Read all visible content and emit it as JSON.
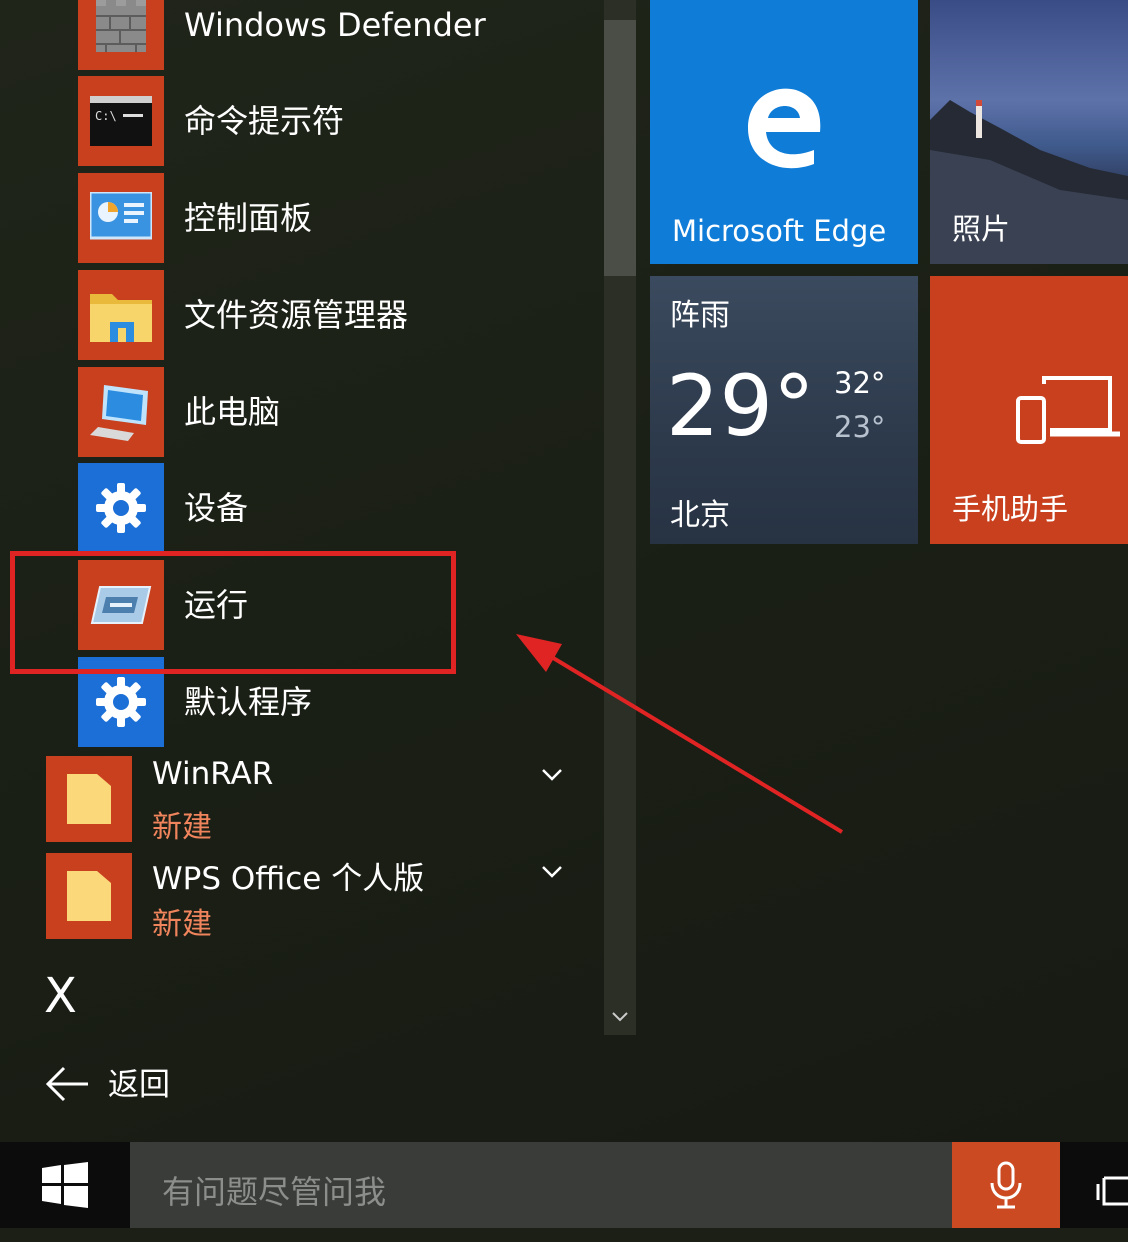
{
  "apps": [
    {
      "label": "Windows Defender",
      "icon": "castle-wall-icon"
    },
    {
      "label": "命令提示符",
      "icon": "command-prompt-icon"
    },
    {
      "label": "控制面板",
      "icon": "control-panel-icon"
    },
    {
      "label": "文件资源管理器",
      "icon": "folder-icon"
    },
    {
      "label": "此电脑",
      "icon": "computer-icon"
    },
    {
      "label": "设备",
      "icon": "gear-icon"
    },
    {
      "label": "运行",
      "icon": "run-icon"
    },
    {
      "label": "默认程序",
      "icon": "gear-icon"
    }
  ],
  "groups": [
    {
      "name": "WinRAR",
      "sub": "新建",
      "icon": "folder-icon"
    },
    {
      "name": "WPS Office 个人版",
      "sub": "新建",
      "icon": "folder-icon"
    }
  ],
  "section_letter": "X",
  "back_label": "返回",
  "tiles": {
    "edge": {
      "label": "Microsoft Edge",
      "color": "#0f7dd8"
    },
    "photos": {
      "label": "照片"
    },
    "weather": {
      "condition": "阵雨",
      "temp": "29°",
      "high": "32°",
      "low": "23°",
      "city": "北京"
    },
    "phone": {
      "label": "手机助手",
      "color": "#c9401f"
    }
  },
  "taskbar": {
    "search_placeholder": "有问题尽管问我"
  },
  "annotation": {
    "highlight_color": "#e02424"
  }
}
